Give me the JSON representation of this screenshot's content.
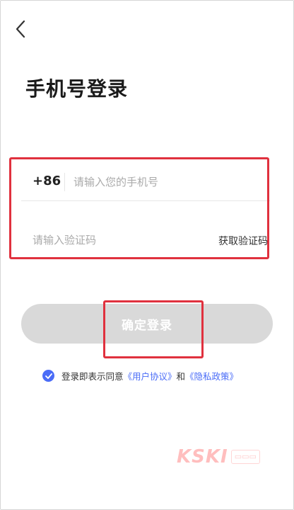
{
  "header": {
    "back_icon": "chevron-left-icon",
    "title": "手机号登录"
  },
  "form": {
    "country_code": "+86",
    "phone_placeholder": "请输入您的手机号",
    "phone_value": "",
    "code_placeholder": "请输入验证码",
    "code_value": "",
    "get_code_label": "获取验证码"
  },
  "login_button": {
    "label": "确定登录",
    "enabled": false,
    "bg_color": "#d9d9d9"
  },
  "agreement": {
    "checked": true,
    "prefix": "登录即表示同意",
    "user_agreement": "《用户协议》",
    "conjunction": "和",
    "privacy_policy": "《隐私政策》",
    "accent_color": "#4a6cf7"
  },
  "annotation_color": "#e0313e",
  "watermark": {
    "brand": "KSKI"
  }
}
